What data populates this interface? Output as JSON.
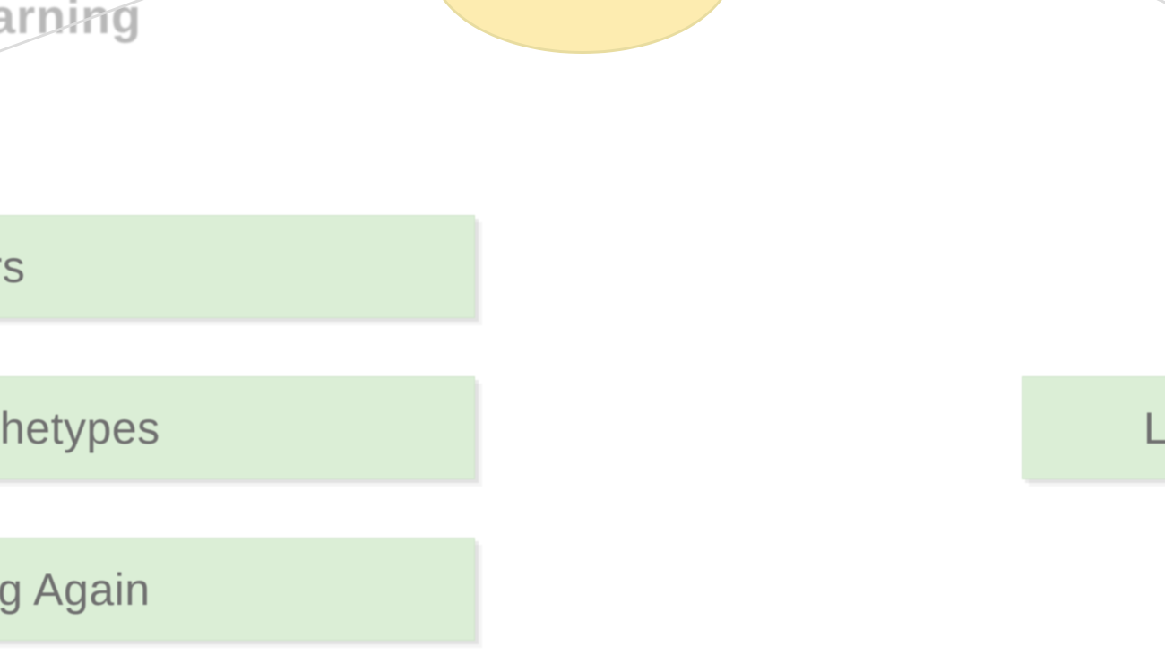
{
  "root": {
    "caption": "learning"
  },
  "left_children": [
    {
      "label": "ears"
    },
    {
      "label": "archetypes"
    },
    {
      "label": "ding Again"
    }
  ],
  "right_children": [
    {
      "label": "L"
    }
  ],
  "colors": {
    "node_fill": "#dbeed6",
    "oval_fill": "#fdecb0"
  }
}
